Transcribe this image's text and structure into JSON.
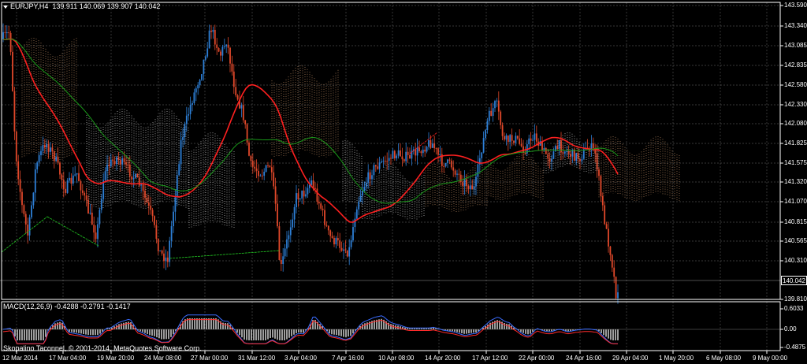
{
  "header": {
    "symbol": "EURJPY,H4",
    "ohlc": "139.911 140.069 139.907 140.042"
  },
  "macd": {
    "title": "MACD(12,26,9) -0.4288 -0.2791 -0.1417",
    "axis_labels": [
      "0.6033",
      "0.00",
      "-0.4875"
    ]
  },
  "copyright": "Skopalino Taconnel, © 2001-2014, MetaQuotes Software Corp.",
  "price_axis": {
    "labels": [
      "143.590",
      "143.340",
      "143.085",
      "142.835",
      "142.580",
      "142.330",
      "142.080",
      "141.825",
      "141.575",
      "141.320",
      "141.070",
      "140.815",
      "140.565",
      "140.310",
      "139.810"
    ],
    "current_price": "140.042"
  },
  "time_axis": {
    "labels": [
      "12 Mar 2014",
      "17 Mar 04:00",
      "19 Mar 20:00",
      "24 Mar 08:00",
      "27 Mar 00:00",
      "31 Mar 12:00",
      "3 Apr 04:00",
      "7 Apr 16:00",
      "10 Apr 08:00",
      "14 Apr 20:00",
      "17 Apr 12:00",
      "22 Apr 00:00",
      "24 Apr 16:00",
      "29 Apr 04:00",
      "1 May 20:00",
      "6 May 08:00",
      "9 May 00:00"
    ]
  },
  "colors": {
    "background": "#000000",
    "grid": "#4a4a4a",
    "bull": "#2d7fd6",
    "bear": "#e0482a",
    "ma_red": "#ff2020",
    "ma_green": "#1a9a1a",
    "cloud_tan": "#c8946a",
    "cloud_white": "#d8d8d8",
    "macd_hist": "#e0e0e0",
    "macd_line": "#3a6cff",
    "signal_line": "#ff2a2a",
    "div_green": "#22cc22"
  }
}
